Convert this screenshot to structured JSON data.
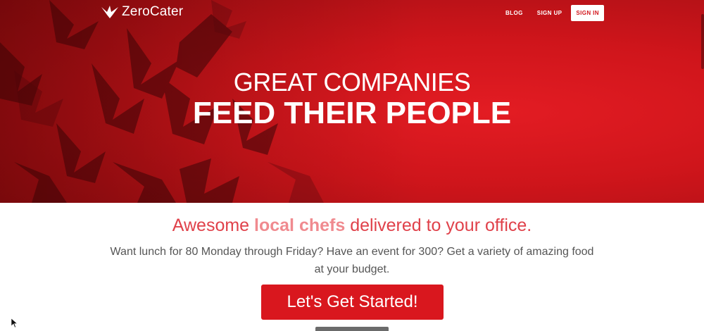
{
  "brand": {
    "name": "ZeroCater"
  },
  "nav": {
    "blog": "BLOG",
    "signup": "SIGN UP",
    "signin": "SIGN IN"
  },
  "hero": {
    "line1": "GREAT COMPANIES",
    "line2": "FEED THEIR PEOPLE"
  },
  "tagline": {
    "before": "Awesome ",
    "highlight": "local chefs",
    "after": " delivered to your office."
  },
  "description": "Want lunch for 80 Monday through Friday? Have an event for 300? Get a variety of amazing food at your budget.",
  "cta": "Let's Get Started!",
  "colors": {
    "brand_red": "#d9171e",
    "hero_red": "#cf151b",
    "tagline_red": "#e0414a",
    "highlight_pink": "#f08a8f"
  }
}
